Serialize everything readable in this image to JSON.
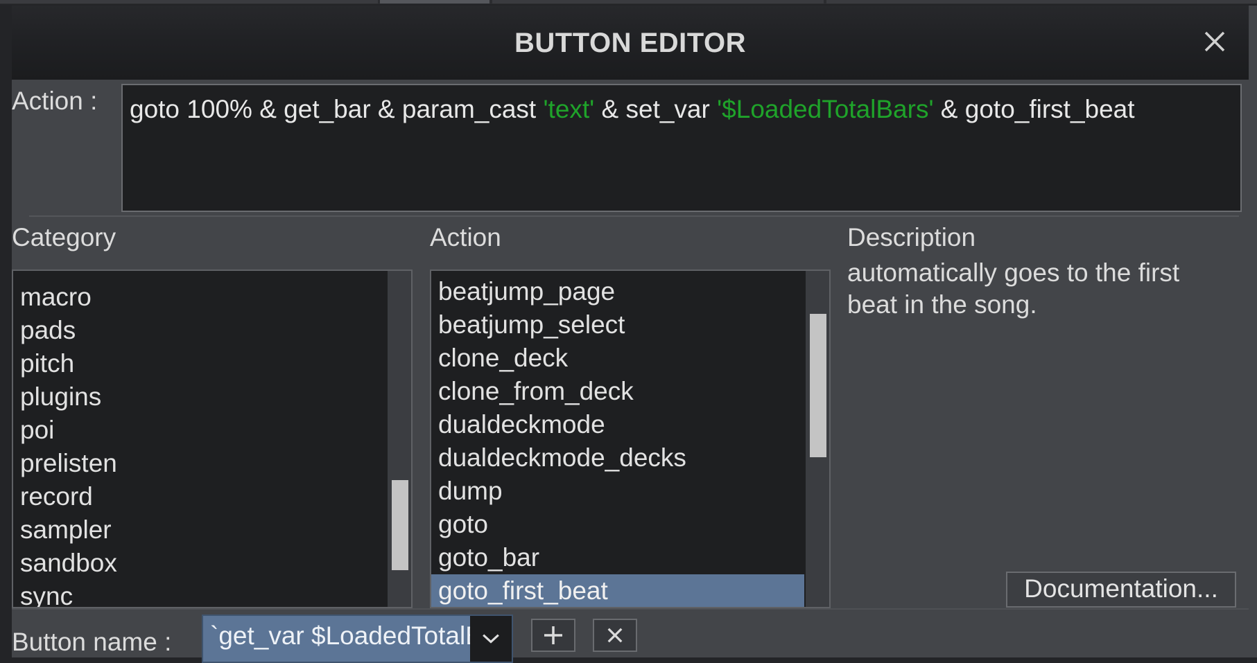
{
  "dialog": {
    "title": "BUTTON EDITOR"
  },
  "action_script": {
    "label": "Action :",
    "parts": [
      {
        "text": "goto 100% & get_bar & param_cast ",
        "kind": "plain"
      },
      {
        "text": "'text'",
        "kind": "string"
      },
      {
        "text": " & set_var ",
        "kind": "plain"
      },
      {
        "text": "'$LoadedTotalBars'",
        "kind": "string"
      },
      {
        "text": " & goto_first_beat",
        "kind": "plain"
      }
    ]
  },
  "category": {
    "header": "Category",
    "items": [
      "macro",
      "pads",
      "pitch",
      "plugins",
      "poi",
      "prelisten",
      "record",
      "sampler",
      "sandbox",
      "sync"
    ]
  },
  "actions": {
    "header": "Action",
    "items": [
      "beatjump_page",
      "beatjump_select",
      "clone_deck",
      "clone_from_deck",
      "dualdeckmode",
      "dualdeckmode_decks",
      "dump",
      "goto",
      "goto_bar",
      "goto_first_beat"
    ],
    "selected": "goto_first_beat"
  },
  "description": {
    "header": "Description",
    "line1": "automatically goes to the first",
    "line2": "beat in the song."
  },
  "documentation_button": "Documentation...",
  "button_name": {
    "label": "Button name :",
    "value": "`get_var $LoadedTotalBars`"
  },
  "icons": {
    "close": "close-icon",
    "dropdown": "chevron-down-icon",
    "add": "plus-icon",
    "delete": "x-icon"
  }
}
